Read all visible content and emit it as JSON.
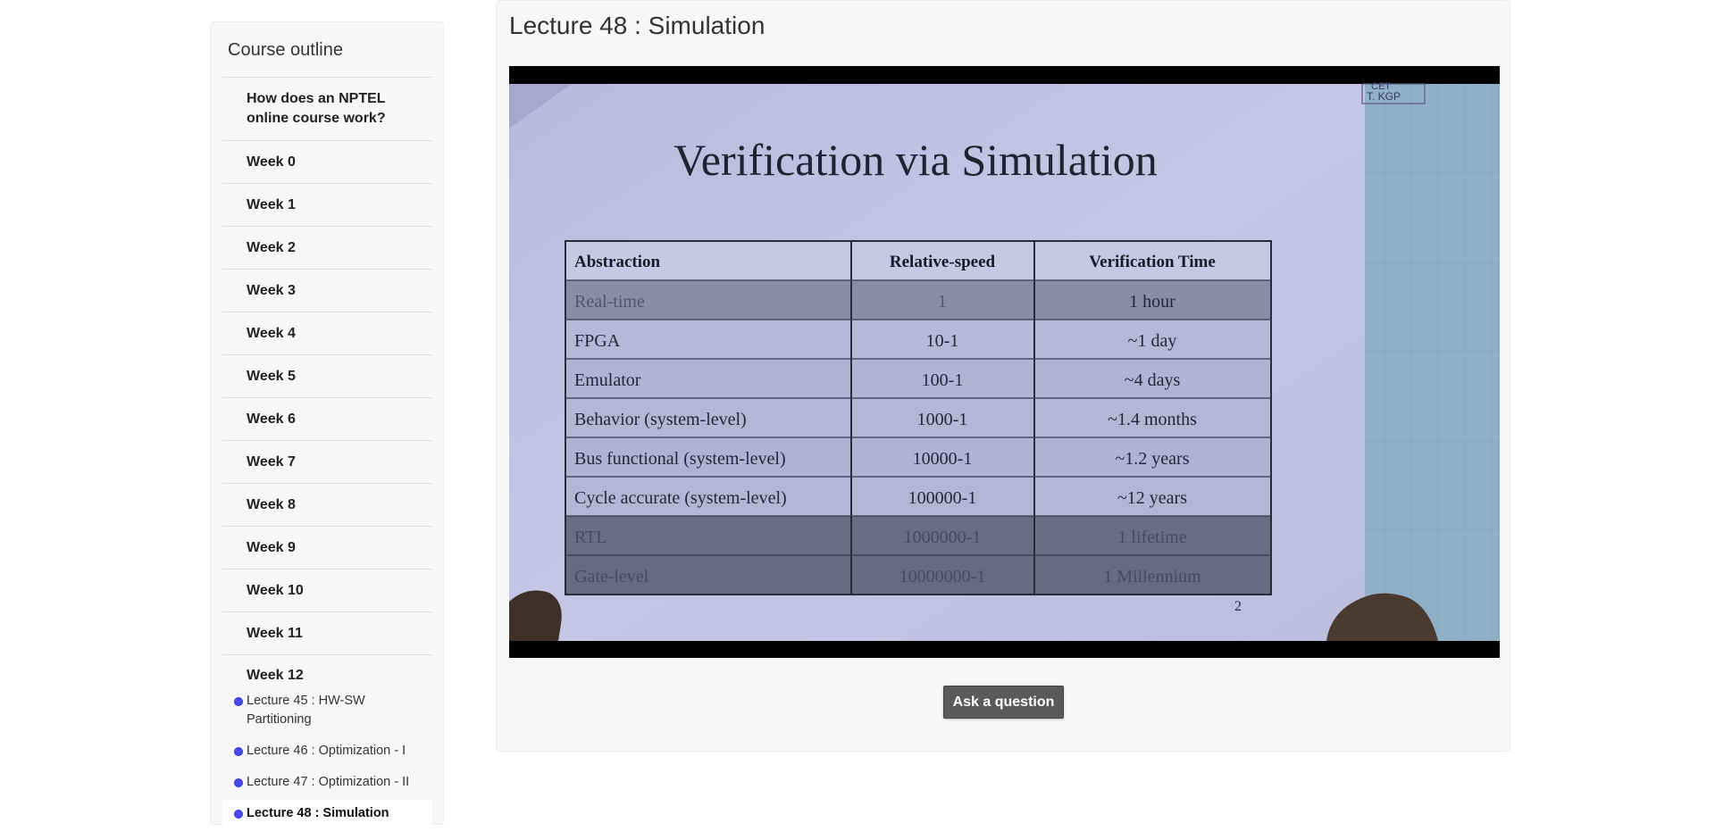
{
  "sidebar": {
    "title": "Course outline",
    "items": [
      {
        "label": "How does an NPTEL online course work?"
      },
      {
        "label": "Week 0"
      },
      {
        "label": "Week 1"
      },
      {
        "label": "Week 2"
      },
      {
        "label": "Week 3"
      },
      {
        "label": "Week 4"
      },
      {
        "label": "Week 5"
      },
      {
        "label": "Week 6"
      },
      {
        "label": "Week 7"
      },
      {
        "label": "Week 8"
      },
      {
        "label": "Week 9"
      },
      {
        "label": "Week 10"
      },
      {
        "label": "Week 11"
      },
      {
        "label": "Week 12"
      }
    ],
    "lectures": [
      {
        "label": "Lecture 45 : HW-SW Partitioning"
      },
      {
        "label": "Lecture 46 : Optimization - I"
      },
      {
        "label": "Lecture 47 : Optimization - II"
      },
      {
        "label": "Lecture 48 : Simulation"
      }
    ],
    "status_color": "#4a4aee"
  },
  "main": {
    "title": "Lecture 48 : Simulation",
    "ask_button": "Ask a question"
  },
  "video": {
    "slide_title": "Verification via Simulation",
    "logo_text": [
      "CET",
      "T. KGP"
    ],
    "table": {
      "headers": [
        "Abstraction",
        "Relative-speed",
        "Verification Time"
      ],
      "rows": [
        {
          "abstraction": "Real-time",
          "speed": "1",
          "time": "1 hour"
        },
        {
          "abstraction": "FPGA",
          "speed": "10-1",
          "time": "~1 day"
        },
        {
          "abstraction": "Emulator",
          "speed": "100-1",
          "time": "~4 days"
        },
        {
          "abstraction": "Behavior (system-level)",
          "speed": "1000-1",
          "time": "~1.4 months"
        },
        {
          "abstraction": "Bus functional (system-level)",
          "speed": "10000-1",
          "time": "~1.2 years"
        },
        {
          "abstraction": "Cycle accurate (system-level)",
          "speed": "100000-1",
          "time": "~12 years"
        },
        {
          "abstraction": "RTL",
          "speed": "1000000-1",
          "time": "1 lifetime"
        },
        {
          "abstraction": "Gate-level",
          "speed": "10000000-1",
          "time": "1 Millennium"
        }
      ]
    },
    "page_number": "2"
  }
}
